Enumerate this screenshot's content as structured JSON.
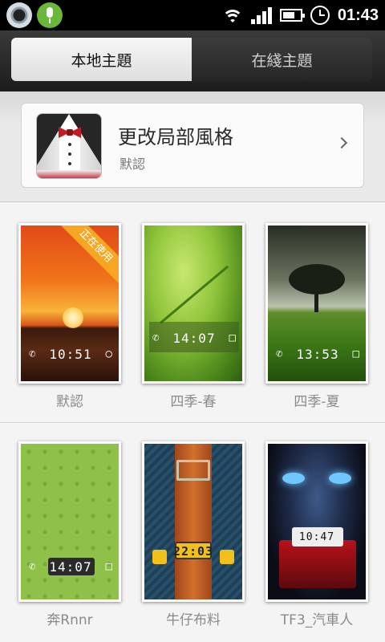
{
  "statusbar": {
    "time": "01:43",
    "apps": [
      "camera-app-icon",
      "voice-input-icon"
    ],
    "icons": [
      "wifi-icon",
      "signal-icon",
      "battery-icon",
      "alarm-icon"
    ]
  },
  "tabs": [
    {
      "label": "本地主題",
      "active": true
    },
    {
      "label": "在綫主題",
      "active": false
    }
  ],
  "style_card": {
    "title": "更改局部風格",
    "subtitle": "默認"
  },
  "themes": [
    {
      "name": "默認",
      "lock_time": "10:51",
      "badge": "正在使用"
    },
    {
      "name": "四季-春",
      "lock_time": "14:07"
    },
    {
      "name": "四季-夏",
      "lock_time": "13:53"
    },
    {
      "name": "奔Rnnr",
      "lock_time": "14:07"
    },
    {
      "name": "牛仔布料",
      "lock_time": "22:03"
    },
    {
      "name": "TF3_汽車人",
      "lock_time": "10:47"
    }
  ]
}
